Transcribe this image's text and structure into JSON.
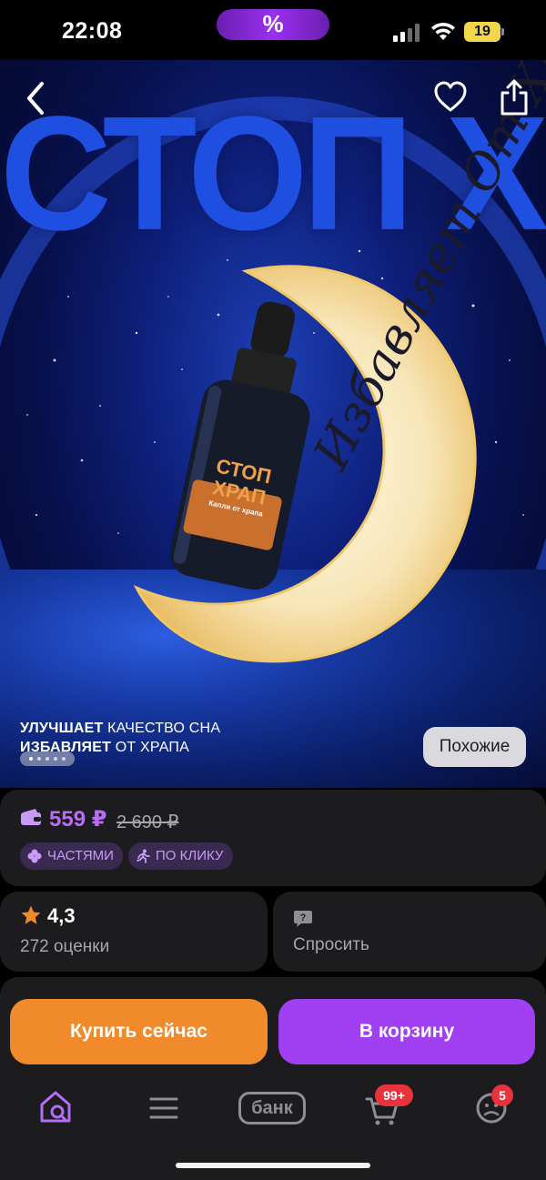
{
  "status_bar": {
    "time": "22:08",
    "pill_symbol": "%",
    "battery": "19"
  },
  "hero": {
    "heading": "СТОП ХРАП",
    "moon_text": "Избавляет От Храпа",
    "bottle": {
      "title_line1": "СТОП",
      "title_line2": "ХРАП",
      "subtitle": "Капли от храпа"
    },
    "caption_line1_bold": "УЛУЧШАЕТ",
    "caption_line1_rest": " КАЧЕСТВО СНА",
    "caption_line2_bold": "ИЗБАВЛЯЕТ",
    "caption_line2_rest": " ОТ ХРАПА",
    "similar_label": "Похожие",
    "image_count": 5,
    "active_image": 1
  },
  "price": {
    "current": "559 ₽",
    "old": "2 690 ₽",
    "badges": [
      {
        "label": "ЧАСТЯМИ",
        "icon": "parts-icon"
      },
      {
        "label": "ПО КЛИКУ",
        "icon": "runner-icon"
      }
    ]
  },
  "rating": {
    "value": "4,3",
    "count": "272 оценки"
  },
  "ask": {
    "label": "Спросить"
  },
  "actions": {
    "buy_now": "Купить сейчас",
    "to_cart": "В корзину"
  },
  "nav": {
    "items": [
      {
        "name": "home",
        "icon": "home-search-icon"
      },
      {
        "name": "catalog",
        "icon": "menu-icon"
      },
      {
        "name": "bank",
        "label": "банк"
      },
      {
        "name": "cart",
        "icon": "cart-icon",
        "badge": "99+"
      },
      {
        "name": "profile",
        "icon": "profile-icon",
        "badge": "5"
      }
    ]
  },
  "colors": {
    "accent_purple": "#a13ff2",
    "accent_orange": "#f08a2a",
    "price_purple": "#b96cf6",
    "badge_red": "#e8323c",
    "card_bg": "#1c1c1e"
  }
}
